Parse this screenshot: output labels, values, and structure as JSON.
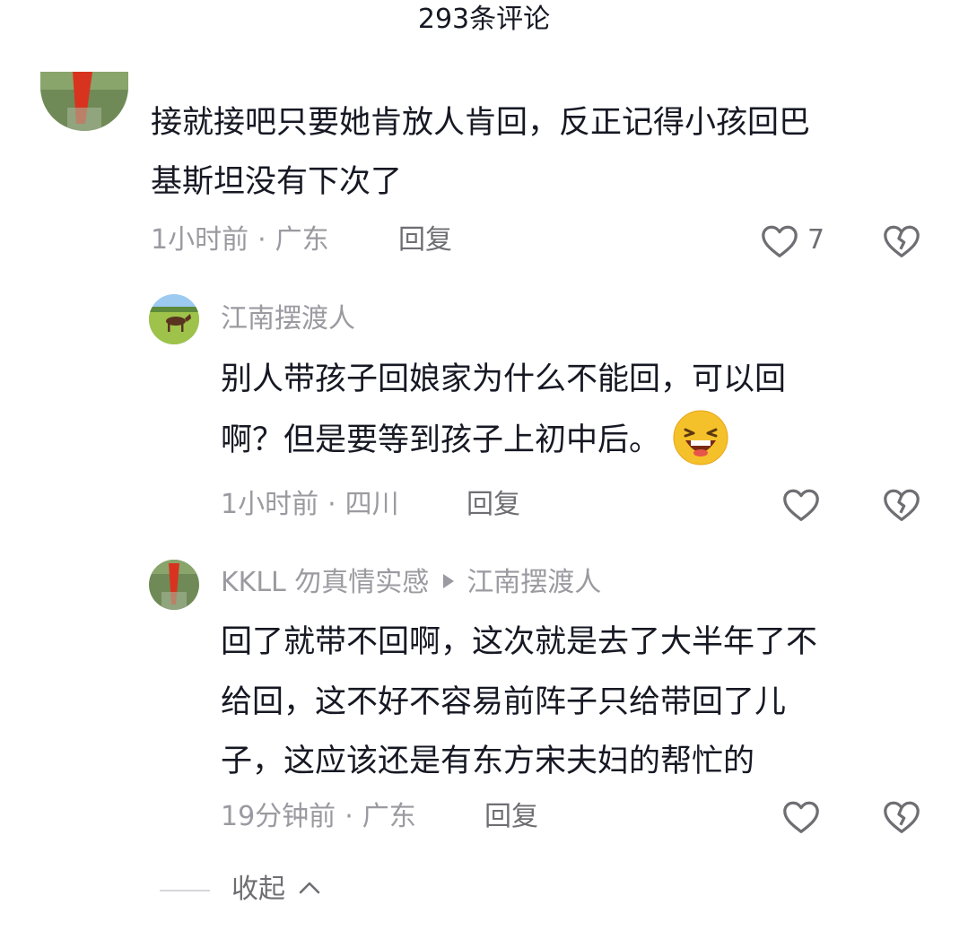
{
  "header": {
    "title": "293条评论"
  },
  "comments": [
    {
      "text_lines": [
        "接就接吧只要她肯放人肯回，反正记得小孩回巴",
        "基斯坦没有下次了"
      ],
      "time": "1小时前",
      "location": "广东",
      "reply_label": "回复",
      "like_count": "7"
    },
    {
      "username": "江南摆渡人",
      "text_lines": [
        "别人带孩子回娘家为什么不能回，可以回",
        "啊？但是要等到孩子上初中后。"
      ],
      "emoji": "laughing-emoji",
      "time": "1小时前",
      "location": "四川",
      "reply_label": "回复"
    },
    {
      "username": "KKLL 勿真情实感",
      "reply_to": "江南摆渡人",
      "text_lines": [
        "回了就带不回啊，这次就是去了大半年了不",
        "给回，这不好不容易前阵子只给带回了儿",
        "子，这应该还是有东方宋夫妇的帮忙的"
      ],
      "time": "19分钟前",
      "location": "广东",
      "reply_label": "回复"
    }
  ],
  "collapse": {
    "label": "收起"
  },
  "meta_separator": "·",
  "icons": [
    "heart-outline-icon",
    "broken-heart-icon",
    "chevron-up-icon"
  ],
  "colors": {
    "text": "#161823",
    "muted": "#9a9aa0",
    "action": "#6e6e73"
  }
}
